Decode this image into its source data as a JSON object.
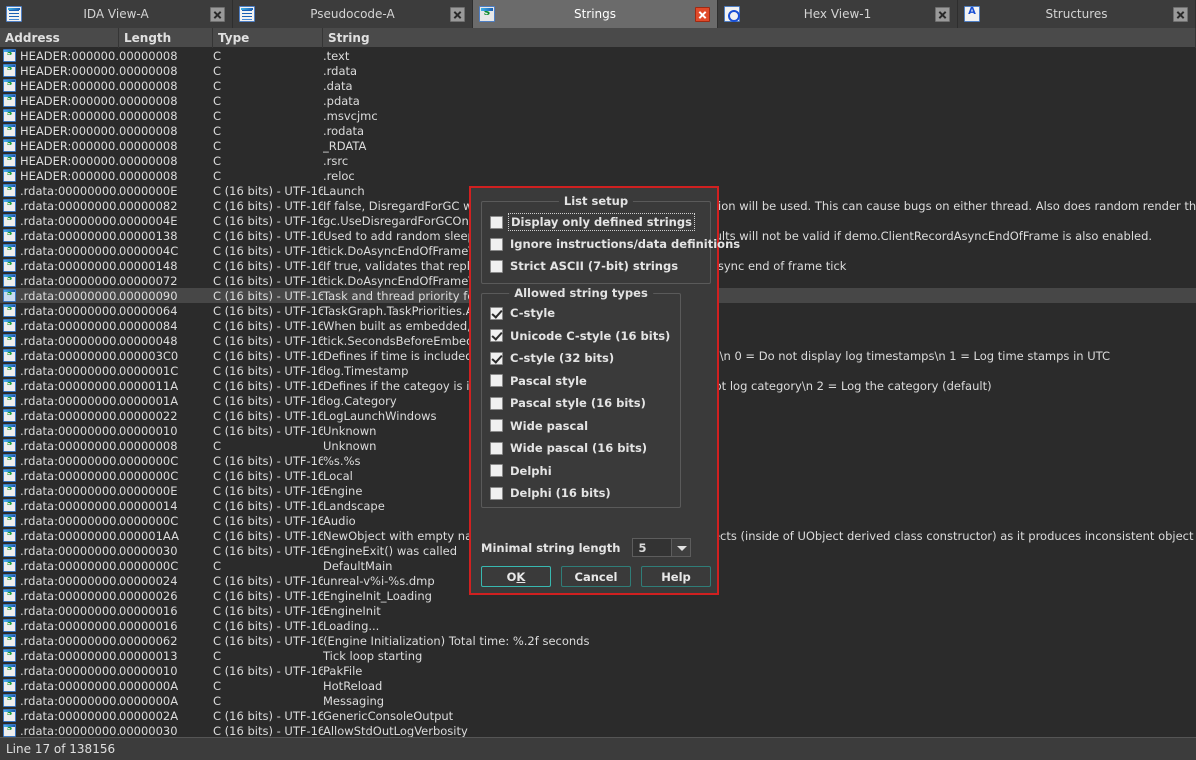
{
  "window": {
    "tabs": [
      {
        "label": "IDA View-A",
        "icon": "ida-view-icon",
        "icon_class": "ico-view",
        "active": false,
        "close_icon": "close-icon"
      },
      {
        "label": "Pseudocode-A",
        "icon": "pseudocode-icon",
        "icon_class": "ico-view",
        "active": false,
        "close_icon": "close-icon"
      },
      {
        "label": "Strings",
        "icon": "strings-icon",
        "icon_class": "ico-strings",
        "active": true,
        "close_icon": "close-icon"
      },
      {
        "label": "Hex View-1",
        "icon": "hex-view-icon",
        "icon_class": "ico-hex",
        "active": false,
        "close_icon": "close-icon"
      },
      {
        "label": "Structures",
        "icon": "structures-icon",
        "icon_class": "ico-struct",
        "active": false,
        "close_icon": "close-icon"
      }
    ]
  },
  "strings_view": {
    "columns": [
      "Address",
      "Length",
      "Type",
      "String"
    ],
    "selected_row_index": 16,
    "rows": [
      {
        "address": "HEADER:000000...",
        "length": "00000008",
        "type": "C",
        "string": ".text"
      },
      {
        "address": "HEADER:000000...",
        "length": "00000008",
        "type": "C",
        "string": ".rdata"
      },
      {
        "address": "HEADER:000000...",
        "length": "00000008",
        "type": "C",
        "string": ".data"
      },
      {
        "address": "HEADER:000000...",
        "length": "00000008",
        "type": "C",
        "string": ".pdata"
      },
      {
        "address": "HEADER:000000...",
        "length": "00000008",
        "type": "C",
        "string": ".msvcjmc"
      },
      {
        "address": "HEADER:000000...",
        "length": "00000008",
        "type": "C",
        "string": ".rodata"
      },
      {
        "address": "HEADER:000000...",
        "length": "00000008",
        "type": "C",
        "string": "_RDATA"
      },
      {
        "address": "HEADER:000000...",
        "length": "00000008",
        "type": "C",
        "string": ".rsrc"
      },
      {
        "address": "HEADER:000000...",
        "length": "00000008",
        "type": "C",
        "string": ".reloc"
      },
      {
        "address": ".rdata:00000000...",
        "length": "0000000E",
        "type": "C (16 bits) - UTF-16LE",
        "string": "Launch"
      },
      {
        "address": ".rdata:00000000...",
        "length": "00000082",
        "type": "C (16 bits) - UTF-16LE",
        "string": "If false, DisregardForGC will be ignored and deferred garbage collection will be used. This can cause bugs on either thread. Also does random render thread flushes from the game thread."
      },
      {
        "address": ".rdata:00000000...",
        "length": "0000004E",
        "type": "C (16 bits) - UTF-16LE",
        "string": "gc.UseDisregardForGCOnDedicatedServers"
      },
      {
        "address": ".rdata:00000000...",
        "length": "00000138",
        "type": "C (16 bits) - UTF-16LE",
        "string": "Used to add random sleeps to the game thread to emulate tick. Results will not be valid if demo.ClientRecordAsyncEndOfFrame is also enabled."
      },
      {
        "address": ".rdata:00000000...",
        "length": "0000004C",
        "type": "C (16 bits) - UTF-16LE",
        "string": "tick.DoAsyncEndOfFrameTasks.RandomTiming"
      },
      {
        "address": ".rdata:00000000...",
        "length": "00000148",
        "type": "C (16 bits) - UTF-16LE",
        "string": "If true, validates that replicated properties are not modified during async end of frame tick"
      },
      {
        "address": ".rdata:00000000...",
        "length": "00000072",
        "type": "C (16 bits) - UTF-16LE",
        "string": "tick.DoAsyncEndOfFrameTasks.Validate"
      },
      {
        "address": ".rdata:00000000...",
        "length": "00000090",
        "type": "C (16 bits) - UTF-16LE",
        "string": "Task and thread priority for the async end of frame task"
      },
      {
        "address": ".rdata:00000000...",
        "length": "00000064",
        "type": "C (16 bits) - UTF-16LE",
        "string": "TaskGraph.TaskPriorities.AsyncEndOfFrame"
      },
      {
        "address": ".rdata:00000000...",
        "length": "00000084",
        "type": "C (16 bits) - UTF-16LE",
        "string": "When built as embedded, how long to wait before ticking"
      },
      {
        "address": ".rdata:00000000...",
        "length": "00000048",
        "type": "C (16 bits) - UTF-16LE",
        "string": "tick.SecondsBeforeEmbeddedAppSleeps"
      },
      {
        "address": ".rdata:00000000...",
        "length": "000003C0",
        "type": "C (16 bits) - UTF-16LE",
        "string": "Defines if time is included in the log output: [time][frame mod 1000]\\n  0 = Do not display log timestamps\\n  1 = Log time stamps in UTC"
      },
      {
        "address": ".rdata:00000000...",
        "length": "0000001C",
        "type": "C (16 bits) - UTF-16LE",
        "string": "log.Timestamp"
      },
      {
        "address": ".rdata:00000000...",
        "length": "0000011A",
        "type": "C (16 bits) - UTF-16LE",
        "string": "Defines if the categoy is included in the log output form.\\n  0 = Do not log category\\n  2 = Log the category (default)"
      },
      {
        "address": ".rdata:00000000...",
        "length": "0000001A",
        "type": "C (16 bits) - UTF-16LE",
        "string": "log.Category"
      },
      {
        "address": ".rdata:00000000...",
        "length": "00000022",
        "type": "C (16 bits) - UTF-16LE",
        "string": "LogLaunchWindows"
      },
      {
        "address": ".rdata:00000000...",
        "length": "00000010",
        "type": "C (16 bits) - UTF-16LE",
        "string": "Unknown"
      },
      {
        "address": ".rdata:00000000...",
        "length": "00000008",
        "type": "C",
        "string": "Unknown"
      },
      {
        "address": ".rdata:00000000...",
        "length": "0000000C",
        "type": "C (16 bits) - UTF-16LE",
        "string": "%s.%s"
      },
      {
        "address": ".rdata:00000000...",
        "length": "0000000C",
        "type": "C (16 bits) - UTF-16LE",
        "string": "Local"
      },
      {
        "address": ".rdata:00000000...",
        "length": "0000000E",
        "type": "C (16 bits) - UTF-16LE",
        "string": "Engine"
      },
      {
        "address": ".rdata:00000000...",
        "length": "00000014",
        "type": "C (16 bits) - UTF-16LE",
        "string": "Landscape"
      },
      {
        "address": ".rdata:00000000...",
        "length": "0000000C",
        "type": "C (16 bits) - UTF-16LE",
        "string": "Audio"
      },
      {
        "address": ".rdata:00000000...",
        "length": "000001AA",
        "type": "C (16 bits) - UTF-16LE",
        "string": "NewObject with empty name can't be used to create default subobjects (inside of UObject derived class constructor) as it produces inconsistent object names. Use Obj"
      },
      {
        "address": ".rdata:00000000...",
        "length": "00000030",
        "type": "C (16 bits) - UTF-16LE",
        "string": "EngineExit() was called"
      },
      {
        "address": ".rdata:00000000...",
        "length": "0000000C",
        "type": "C",
        "string": "DefaultMain"
      },
      {
        "address": ".rdata:00000000...",
        "length": "00000024",
        "type": "C (16 bits) - UTF-16LE",
        "string": "unreal-v%i-%s.dmp"
      },
      {
        "address": ".rdata:00000000...",
        "length": "00000026",
        "type": "C (16 bits) - UTF-16LE",
        "string": "EngineInit_Loading"
      },
      {
        "address": ".rdata:00000000...",
        "length": "00000016",
        "type": "C (16 bits) - UTF-16LE",
        "string": "EngineInit"
      },
      {
        "address": ".rdata:00000000...",
        "length": "00000016",
        "type": "C (16 bits) - UTF-16LE",
        "string": "Loading..."
      },
      {
        "address": ".rdata:00000000...",
        "length": "00000062",
        "type": "C (16 bits) - UTF-16LE",
        "string": "(Engine Initialization) Total time: %.2f seconds"
      },
      {
        "address": ".rdata:00000000...",
        "length": "00000013",
        "type": "C",
        "string": "Tick loop starting"
      },
      {
        "address": ".rdata:00000000...",
        "length": "00000010",
        "type": "C (16 bits) - UTF-16LE",
        "string": "PakFile"
      },
      {
        "address": ".rdata:00000000...",
        "length": "0000000A",
        "type": "C",
        "string": "HotReload"
      },
      {
        "address": ".rdata:00000000...",
        "length": "0000000A",
        "type": "C",
        "string": "Messaging"
      },
      {
        "address": ".rdata:00000000...",
        "length": "0000002A",
        "type": "C (16 bits) - UTF-16LE",
        "string": "GenericConsoleOutput"
      },
      {
        "address": ".rdata:00000000...",
        "length": "00000030",
        "type": "C (16 bits) - UTF-16LE",
        "string": "AllowStdOutLogVerbosity"
      }
    ]
  },
  "status_bar": {
    "text": "Line 17 of 138156"
  },
  "dialog": {
    "border_color": "#d02020",
    "list_setup": {
      "legend": "List setup",
      "options": [
        {
          "label": "Display only defined strings",
          "checked": false,
          "focused": true
        },
        {
          "label": "Ignore instructions/data definitions",
          "checked": false,
          "focused": false
        },
        {
          "label": "Strict ASCII (7-bit) strings",
          "checked": false,
          "focused": false
        }
      ]
    },
    "allowed_string_types": {
      "legend": "Allowed string types",
      "options": [
        {
          "label": "C-style",
          "checked": true
        },
        {
          "label": "Unicode C-style (16 bits)",
          "checked": true
        },
        {
          "label": "C-style (32 bits)",
          "checked": true
        },
        {
          "label": "Pascal style",
          "checked": false
        },
        {
          "label": "Pascal style (16 bits)",
          "checked": false
        },
        {
          "label": "Wide pascal",
          "checked": false
        },
        {
          "label": "Wide pascal (16 bits)",
          "checked": false
        },
        {
          "label": "Delphi",
          "checked": false
        },
        {
          "label": "Delphi (16 bits)",
          "checked": false
        }
      ]
    },
    "minimal_string_length": {
      "label": "Minimal string length",
      "value": "5"
    },
    "buttons": [
      {
        "label": "OK",
        "accel": "K",
        "default": true
      },
      {
        "label": "Cancel",
        "accel": "",
        "default": false
      },
      {
        "label": "Help",
        "accel": "",
        "default": false
      }
    ]
  }
}
